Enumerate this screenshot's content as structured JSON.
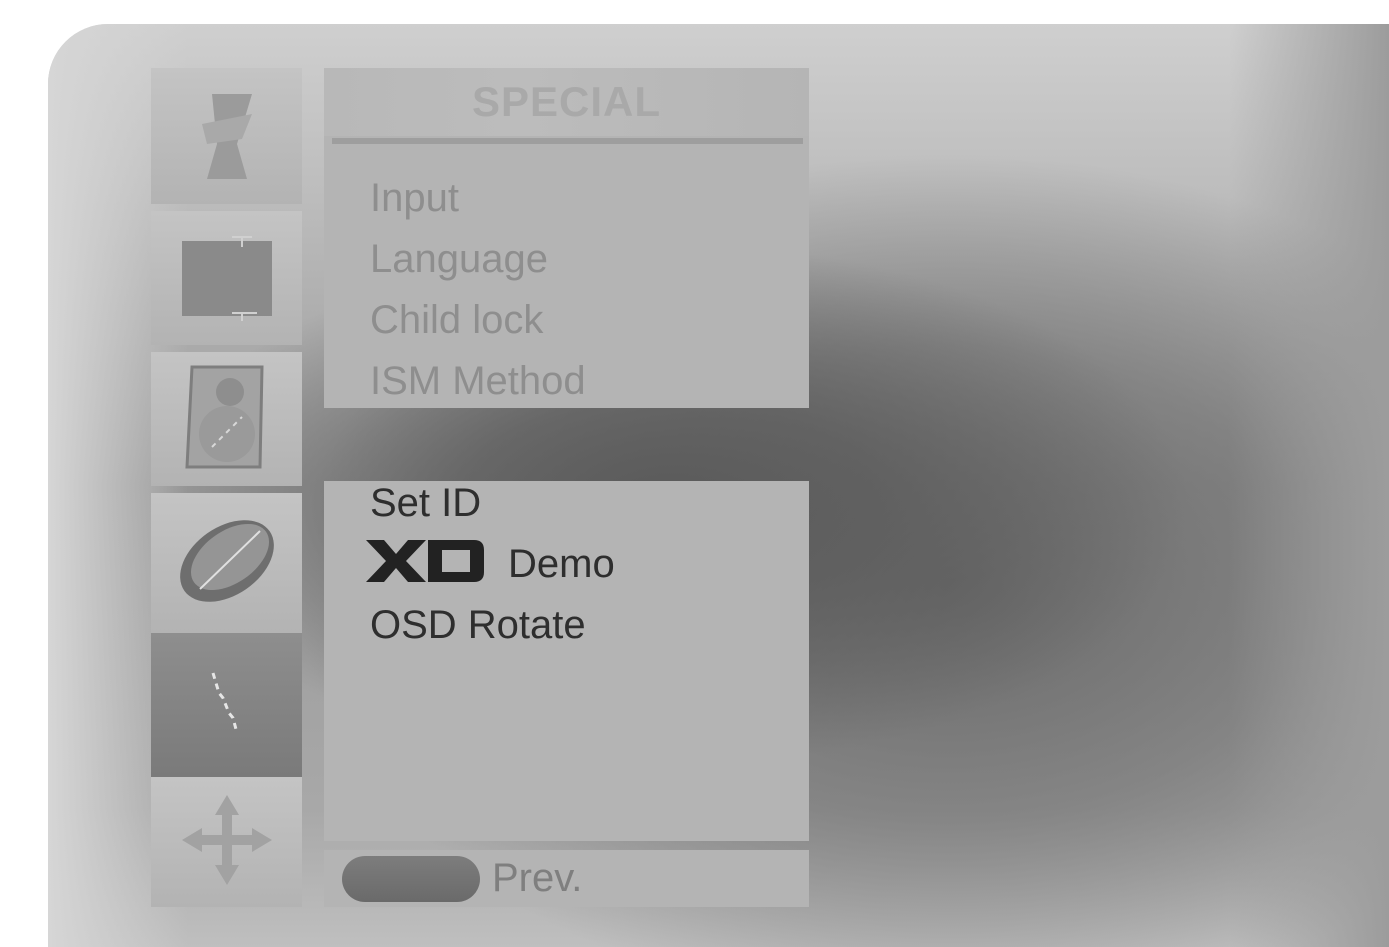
{
  "menu": {
    "title": "SPECIAL",
    "items_top": [
      "Input",
      "Language",
      "Child lock",
      "ISM Method"
    ],
    "items_bottom": {
      "set_id": "Set ID",
      "xd_demo": "Demo",
      "osd_rotate": "OSD Rotate"
    }
  },
  "footer": {
    "prev_label": "Prev."
  },
  "icons": {
    "tile_1": "picture-icon",
    "tile_2": "screen-icon",
    "tile_3": "sound-icon",
    "tile_4": "time-icon",
    "tile_5": "special-icon",
    "tile_6": "move-icon"
  }
}
